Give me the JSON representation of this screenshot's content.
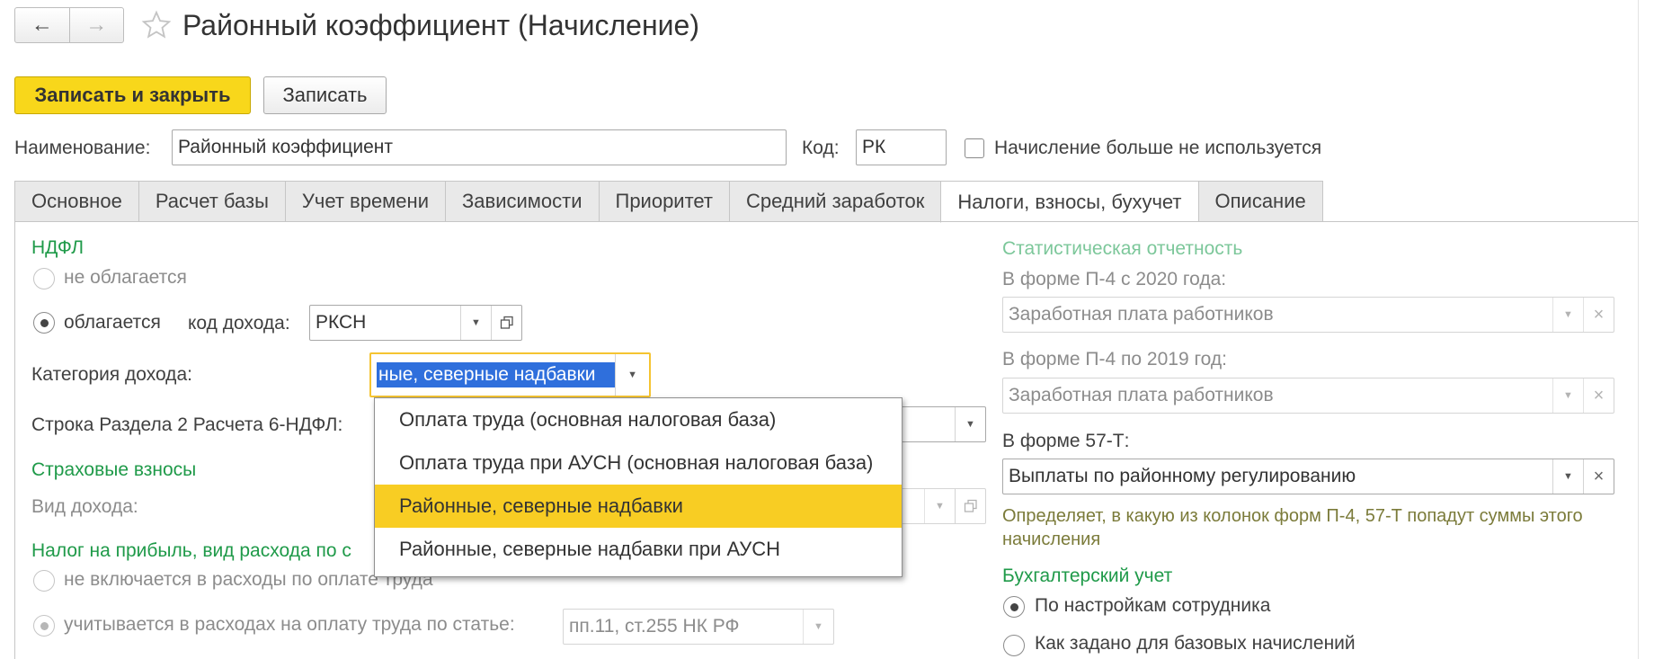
{
  "window": {
    "title": "Районный коэффициент (Начисление)"
  },
  "toolbar": {
    "save_close_label": "Записать и закрыть",
    "save_label": "Записать"
  },
  "header": {
    "name_label": "Наименование:",
    "name_value": "Районный коэффициент",
    "code_label": "Код:",
    "code_value": "РК",
    "unused_label": "Начисление больше не используется"
  },
  "tabs": [
    {
      "label": "Основное"
    },
    {
      "label": "Расчет базы"
    },
    {
      "label": "Учет времени"
    },
    {
      "label": "Зависимости"
    },
    {
      "label": "Приоритет"
    },
    {
      "label": "Средний заработок"
    },
    {
      "label": "Налоги, взносы, бухучет"
    },
    {
      "label": "Описание"
    }
  ],
  "ndfl": {
    "title": "НДФЛ",
    "not_taxed_label": "не облагается",
    "taxed_label": "облагается",
    "income_code_label": "код дохода:",
    "income_code_value": "РКСН",
    "income_category_label": "Категория дохода:",
    "income_category_value": "ные, северные надбавки",
    "line_6ndfl_label": "Строка Раздела 2 Расчета 6-НДФЛ:"
  },
  "dropdown": {
    "items": [
      {
        "label": "Оплата труда (основная налоговая база)"
      },
      {
        "label": "Оплата труда при АУСН (основная налоговая база)"
      },
      {
        "label": "Районные, северные надбавки"
      },
      {
        "label": "Районные, северные надбавки при АУСН"
      }
    ],
    "selected_index": 2
  },
  "insurance": {
    "title": "Страховые взносы",
    "income_type_label": "Вид дохода:"
  },
  "profit_tax": {
    "title": "Налог на прибыль, вид расхода по с",
    "not_included_label": "не включается в расходы по оплате труда",
    "included_label": "учитывается в расходах на оплату труда по статье:",
    "article_value": "пп.11, ст.255 НК РФ"
  },
  "statistics": {
    "title": "Статистическая отчетность",
    "p4_2020_label": "В форме П-4 с 2020 года:",
    "p4_2020_value": "Заработная плата работников",
    "p4_2019_label": "В форме П-4 по 2019 год:",
    "p4_2019_value": "Заработная плата работников",
    "f57t_label": "В форме 57-Т:",
    "f57t_value": "Выплаты по районному регулированию",
    "hint": "Определяет, в какую из колонок форм П-4, 57-Т попадут суммы этого начисления"
  },
  "accounting": {
    "title": "Бухгалтерский учет",
    "by_employee_label": "По настройкам сотрудника",
    "as_base_label": "Как задано для базовых начислений"
  },
  "colors": {
    "accent_green": "#1f9a49",
    "primary_button": "#f8d71b",
    "highlight": "#f8cd23",
    "selection": "#2f6fdc"
  }
}
